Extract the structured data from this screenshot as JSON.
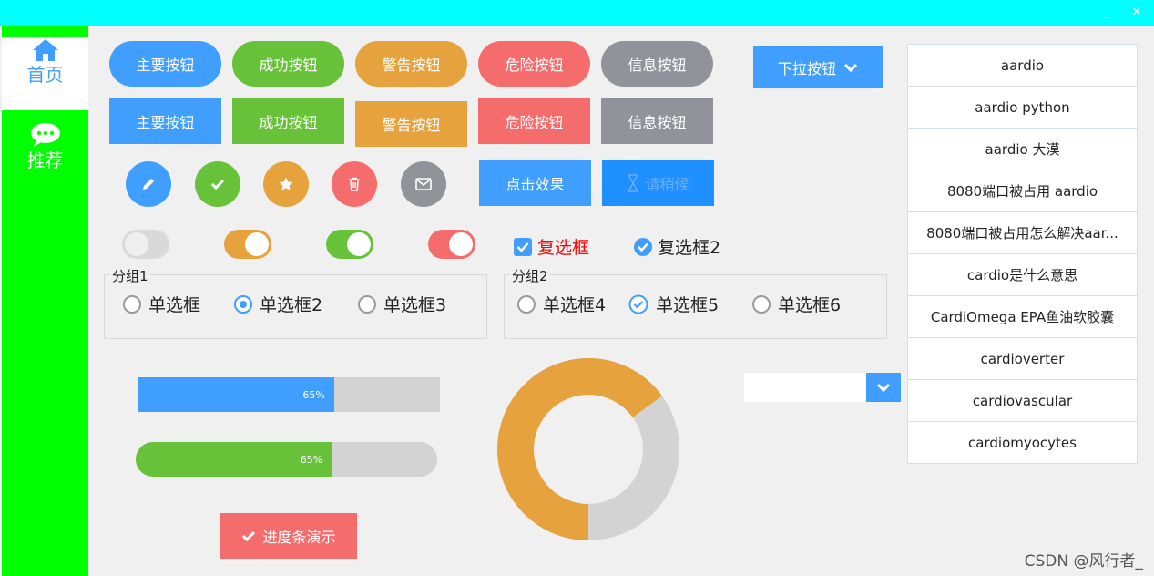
{
  "window": {
    "minimize_label": "_",
    "close_label": "✕"
  },
  "sidebar": {
    "items": [
      {
        "label": "首页",
        "icon": "home-icon",
        "selected": true
      },
      {
        "label": "推荐",
        "icon": "chat-icon",
        "selected": false
      }
    ]
  },
  "buttons": {
    "pill": [
      "主要按钮",
      "成功按钮",
      "警告按钮",
      "危险按钮",
      "信息按钮"
    ],
    "square": [
      "主要按钮",
      "成功按钮",
      "警告按钮",
      "危险按钮",
      "信息按钮"
    ],
    "icons": [
      "edit-icon",
      "check-icon",
      "star-icon",
      "trash-icon",
      "mail-icon"
    ],
    "click_effect": "点击效果",
    "loading": "请稍候",
    "dropdown": "下拉按钮"
  },
  "toggles": [
    {
      "on": false,
      "color": "#d9d9d9"
    },
    {
      "on": true,
      "color": "#e6a23c"
    },
    {
      "on": true,
      "color": "#67c23a"
    },
    {
      "on": true,
      "color": "#f56c6c"
    }
  ],
  "checkboxes": [
    {
      "label": "复选框",
      "checked": true,
      "color": "#ff0000"
    },
    {
      "label": "复选框2",
      "checked": true,
      "color": "#222222"
    }
  ],
  "groups": [
    {
      "title": "分组1",
      "options": [
        "单选框",
        "单选框2",
        "单选框3"
      ],
      "selected": 1
    },
    {
      "title": "分组2",
      "options": [
        "单选框4",
        "单选框5",
        "单选框6"
      ],
      "selected": 1
    }
  ],
  "progress": {
    "bar1": {
      "value": 0.65,
      "text": "65%",
      "color": "#409eff"
    },
    "bar2": {
      "value": 0.65,
      "text": "65%",
      "color": "#67c23a"
    },
    "ring": {
      "value": 0.65,
      "color": "#e6a23c",
      "track": "#d3d3d3"
    },
    "demo_button": "进度条演示"
  },
  "combo": {
    "value": ""
  },
  "list": [
    "aardio",
    "aardio python",
    "aardio 大漠",
    "8080端口被占用 aardio",
    "8080端口被占用怎么解决aar...",
    "cardio是什么意思",
    "CardiOmega  EPA鱼油软胶囊",
    "cardioverter",
    "cardiovascular",
    "cardiomyocytes"
  ],
  "watermark": "CSDN @风行者_",
  "colors": {
    "primary": "#409eff",
    "success": "#67c23a",
    "warning": "#e6a23c",
    "danger": "#f56c6c",
    "info": "#909399"
  }
}
